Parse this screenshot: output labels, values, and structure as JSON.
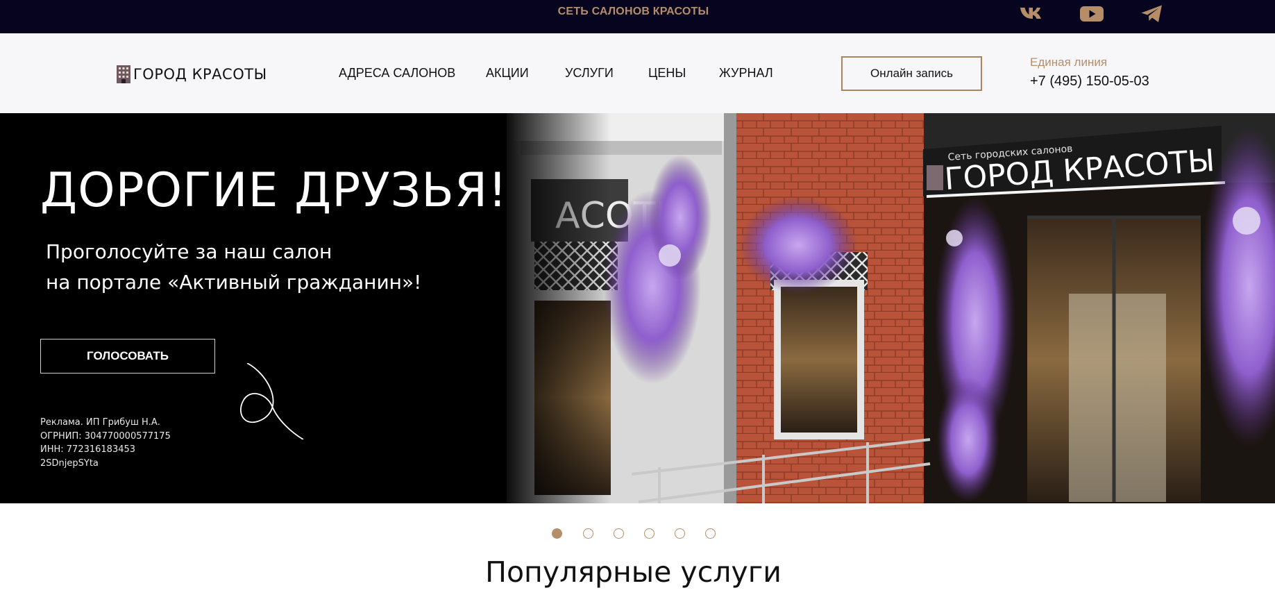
{
  "topbar": {
    "title": "СЕТЬ САЛОНОВ КРАСОТЫ",
    "social": [
      {
        "name": "vk-icon"
      },
      {
        "name": "youtube-icon"
      },
      {
        "name": "telegram-icon"
      }
    ]
  },
  "header": {
    "logo_text": "ГОРОД КРАСОТЫ",
    "nav": [
      {
        "label": "АДРЕСА САЛОНОВ"
      },
      {
        "label": "АКЦИИ"
      },
      {
        "label": "УСЛУГИ"
      },
      {
        "label": "ЦЕНЫ"
      },
      {
        "label": "ЖУРНАЛ"
      }
    ],
    "book_button": "Онлайн запись",
    "hotline_label": "Единая линия",
    "hotline_phone": "+7 (495) 150-05-03"
  },
  "hero": {
    "title": "ДОРОГИЕ ДРУЗЬЯ!",
    "subtitle_line1": "Проголосуйте за наш салон",
    "subtitle_line2": "на портале «Активный гражданин»!",
    "vote_button": "ГОЛОСОВАТЬ",
    "legal": [
      "Реклама. ИП Грибуш Н.А.",
      "ОГРНИП: 304770000577175",
      "ИНН: 772316183453",
      "2SDnjepSYta"
    ],
    "photo_sign_small": "Сеть городских салонов",
    "photo_sign_big": "ГОРОД КРАСОТЫ",
    "photo_sign_side": "АСОТЫ"
  },
  "carousel": {
    "count": 6,
    "active": 1
  },
  "section_title": "Популярные услуги",
  "colors": {
    "accent": "#b58e69",
    "topbar_bg": "#07041f",
    "header_bg": "#f7f7fa"
  }
}
